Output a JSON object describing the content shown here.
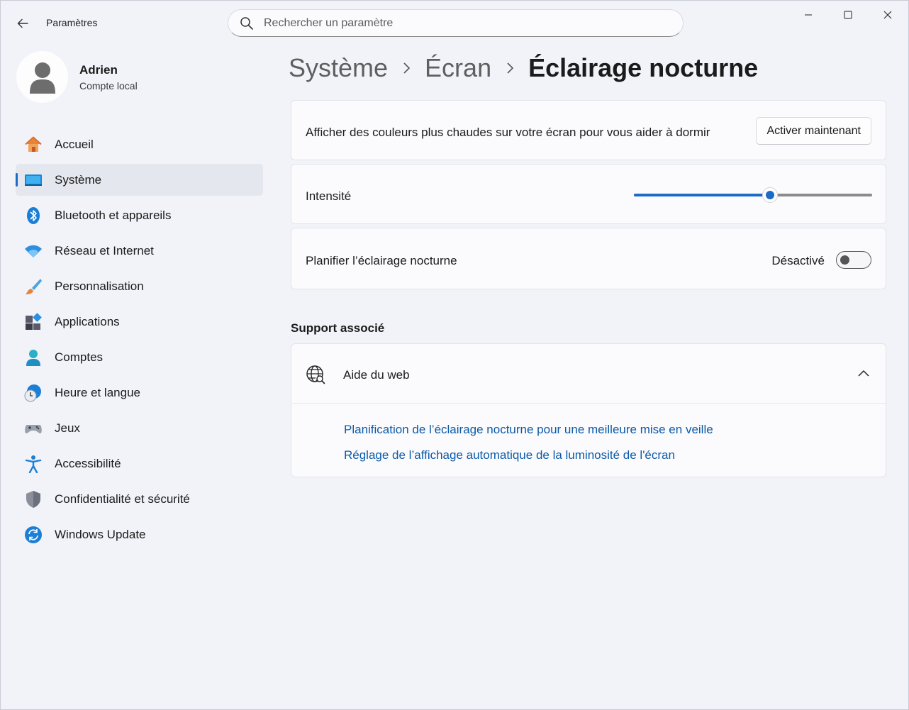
{
  "app": {
    "title": "Paramètres"
  },
  "search": {
    "placeholder": "Rechercher un paramètre"
  },
  "profile": {
    "name": "Adrien",
    "subtitle": "Compte local"
  },
  "sidebar": {
    "items": [
      {
        "label": "Accueil",
        "icon": "home-icon"
      },
      {
        "label": "Système",
        "icon": "system-icon",
        "active": true
      },
      {
        "label": "Bluetooth et appareils",
        "icon": "bluetooth-icon"
      },
      {
        "label": "Réseau et Internet",
        "icon": "wifi-icon"
      },
      {
        "label": "Personnalisation",
        "icon": "brush-icon"
      },
      {
        "label": "Applications",
        "icon": "apps-icon"
      },
      {
        "label": "Comptes",
        "icon": "account-icon"
      },
      {
        "label": "Heure et langue",
        "icon": "clock-globe-icon"
      },
      {
        "label": "Jeux",
        "icon": "gamepad-icon"
      },
      {
        "label": "Accessibilité",
        "icon": "accessibility-icon"
      },
      {
        "label": "Confidentialité et sécurité",
        "icon": "shield-icon"
      },
      {
        "label": "Windows Update",
        "icon": "update-icon"
      }
    ]
  },
  "breadcrumb": {
    "level1": "Système",
    "level2": "Écran",
    "current": "Éclairage nocturne"
  },
  "settings": {
    "activate": {
      "label": "Afficher des couleurs plus chaudes sur votre écran pour vous aider à dormir",
      "button": "Activer maintenant"
    },
    "intensity": {
      "label": "Intensité",
      "value_percent": 57
    },
    "schedule": {
      "label": "Planifier l’éclairage nocturne",
      "state": "Désactivé",
      "on": false
    }
  },
  "support": {
    "title": "Support associé",
    "expander_title": "Aide du web",
    "links": [
      "Planification de l’éclairage nocturne pour une meilleure mise en veille",
      "Réglage de l’affichage automatique de la luminosité de l'écran"
    ]
  },
  "colors": {
    "accent": "#1c6bc7",
    "link": "#0b5aa8",
    "background": "#f1f3f9"
  }
}
